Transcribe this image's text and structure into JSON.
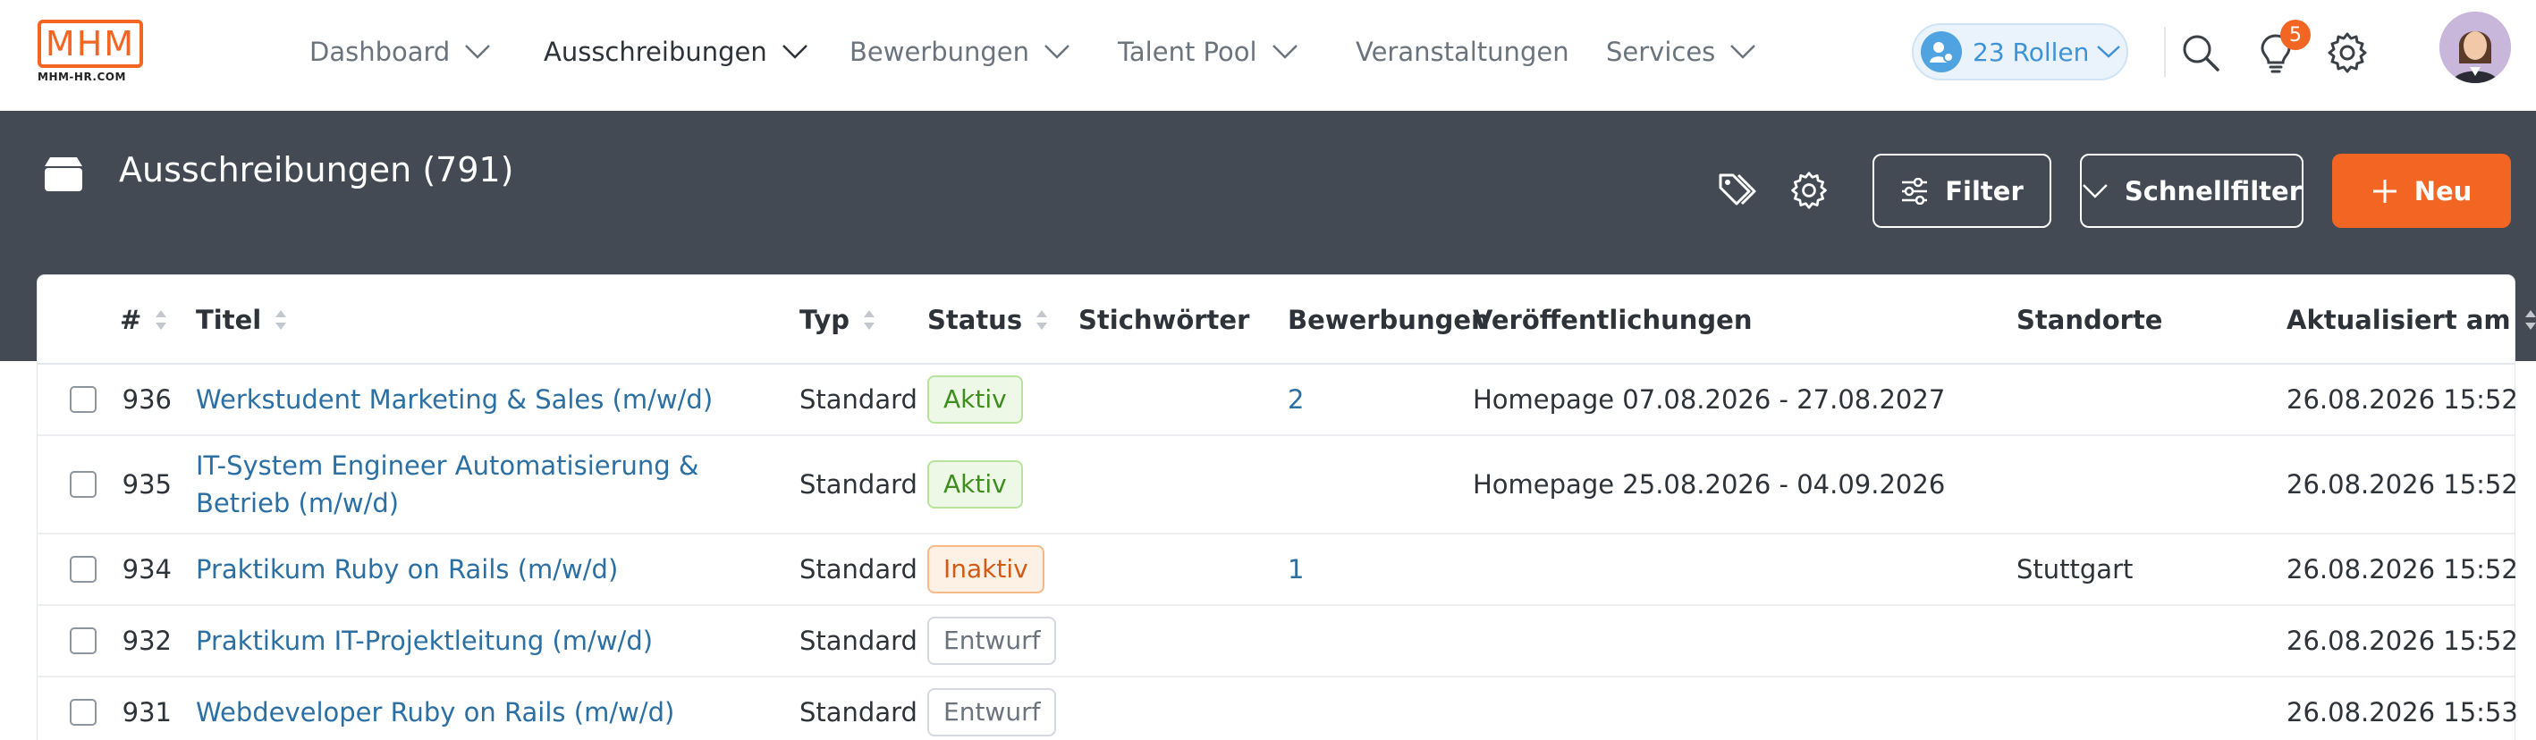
{
  "brand": {
    "logo_text": "MHM",
    "logo_sub": "MHM-HR.COM",
    "accent": "#f26522"
  },
  "nav": {
    "items": [
      {
        "label": "Dashboard",
        "has_menu": true
      },
      {
        "label": "Ausschreibungen",
        "has_menu": true,
        "active": true
      },
      {
        "label": "Bewerbungen",
        "has_menu": true
      },
      {
        "label": "Talent Pool",
        "has_menu": true
      },
      {
        "label": "Veranstaltungen",
        "has_menu": false
      },
      {
        "label": "Services",
        "has_menu": true
      }
    ],
    "roles_label": "23 Rollen",
    "notification_count": "5"
  },
  "header": {
    "title": "Ausschreibungen (791)",
    "filter_label": "Filter",
    "quickfilter_label": "Schnellfilter",
    "new_label": "Neu",
    "band_color": "#434a53"
  },
  "table": {
    "columns": [
      "#",
      "Titel",
      "Typ",
      "Status",
      "Stichwörter",
      "Bewerbungen",
      "Veröffentlichungen",
      "Standorte",
      "Aktualisiert am"
    ],
    "rows": [
      {
        "id": "936",
        "title": "Werkstudent Marketing & Sales (m/w/d)",
        "type": "Standard",
        "status": "Aktiv",
        "keywords": "",
        "applications": "2",
        "publications": "Homepage 07.08.2026 - 27.08.2027",
        "locations": "",
        "updated": "26.08.2026 15:52"
      },
      {
        "id": "935",
        "title": "IT-System Engineer Automatisierung & Betrieb (m/w/d)",
        "type": "Standard",
        "status": "Aktiv",
        "keywords": "",
        "applications": "",
        "publications": "Homepage 25.08.2026 - 04.09.2026",
        "locations": "",
        "updated": "26.08.2026 15:52"
      },
      {
        "id": "934",
        "title": "Praktikum Ruby on Rails (m/w/d)",
        "type": "Standard",
        "status": "Inaktiv",
        "keywords": "",
        "applications": "1",
        "publications": "",
        "locations": "Stuttgart",
        "updated": "26.08.2026 15:52"
      },
      {
        "id": "932",
        "title": "Praktikum IT-Projektleitung (m/w/d)",
        "type": "Standard",
        "status": "Entwurf",
        "keywords": "",
        "applications": "",
        "publications": "",
        "locations": "",
        "updated": "26.08.2026 15:52"
      },
      {
        "id": "931",
        "title": "Webdeveloper Ruby on Rails (m/w/d)",
        "type": "Standard",
        "status": "Entwurf",
        "keywords": "",
        "applications": "",
        "publications": "",
        "locations": "",
        "updated": "26.08.2026 15:53"
      }
    ]
  }
}
